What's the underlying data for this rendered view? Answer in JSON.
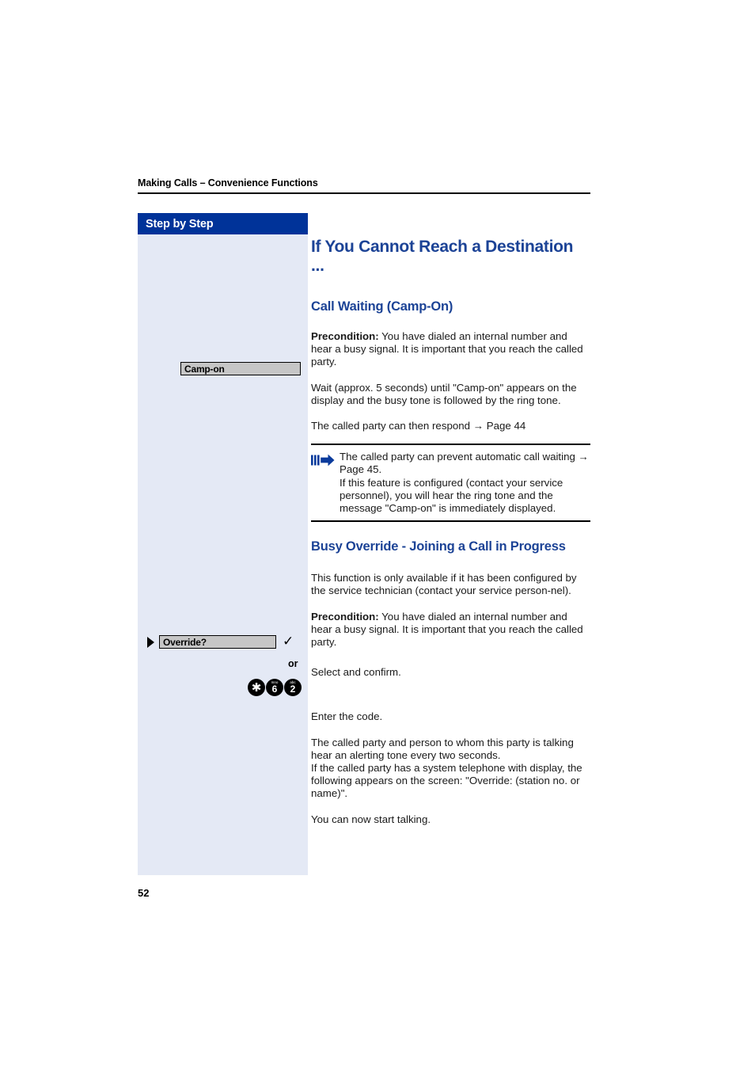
{
  "running_head": {
    "text": "Making Calls – Convenience Functions"
  },
  "sidebar": {
    "header_label": "Step by Step",
    "background_color": "#e4e9f5",
    "header_color": "#003399",
    "items": [
      {
        "type": "display",
        "label": "Camp-on"
      },
      {
        "type": "display",
        "label": "Override?",
        "has_pointer": true,
        "has_check": true
      },
      {
        "type": "or",
        "label": "or"
      },
      {
        "type": "keys",
        "keys": [
          {
            "main": "✱",
            "sub": ""
          },
          {
            "main": "6",
            "sub": "mno"
          },
          {
            "main": "2",
            "sub": "abc"
          }
        ]
      }
    ]
  },
  "main": {
    "title": "If You Cannot Reach a Destination ...",
    "heading_color": "#1c4396",
    "section1": {
      "heading": "Call Waiting (Camp-On)",
      "precondition_label": "Precondition:",
      "precondition_text": " You have dialed an internal number and hear a busy signal. It is important that you reach the called party.",
      "paragraph_wait": "Wait (approx. 5 seconds) until \"Camp-on\" appears on the display and the busy tone is followed by the ring tone.",
      "paragraph_respond": "The called party can then respond → Page 44"
    },
    "note": {
      "icon": "arrow-note-icon",
      "text_1": "The called party can prevent automatic call waiting → Page 45.",
      "text_2": "If this feature is configured (contact your service personnel), you will hear the ring tone and the message \"Camp-on\" is immediately displayed."
    },
    "section2": {
      "heading": "Busy Override - Joining a Call in Progress",
      "paragraph_avail": "This function is only available if it has been configured by the service technician (contact your service person-nel).",
      "precondition_label": "Precondition:",
      "precondition_text": " You have dialed an internal number and hear a busy signal. It is important that you reach the called party.",
      "paragraph_select": "Select and confirm.",
      "paragraph_enter_code": "Enter the code.",
      "paragraph_alerting": "The called party and person to whom this party is talking hear an alerting tone every two seconds.\nIf the called party has a system telephone with display, the following appears on the screen: \"Override: (station no. or name)\".",
      "paragraph_talking": "You can now start talking."
    }
  },
  "folio": {
    "page_number": "52"
  }
}
